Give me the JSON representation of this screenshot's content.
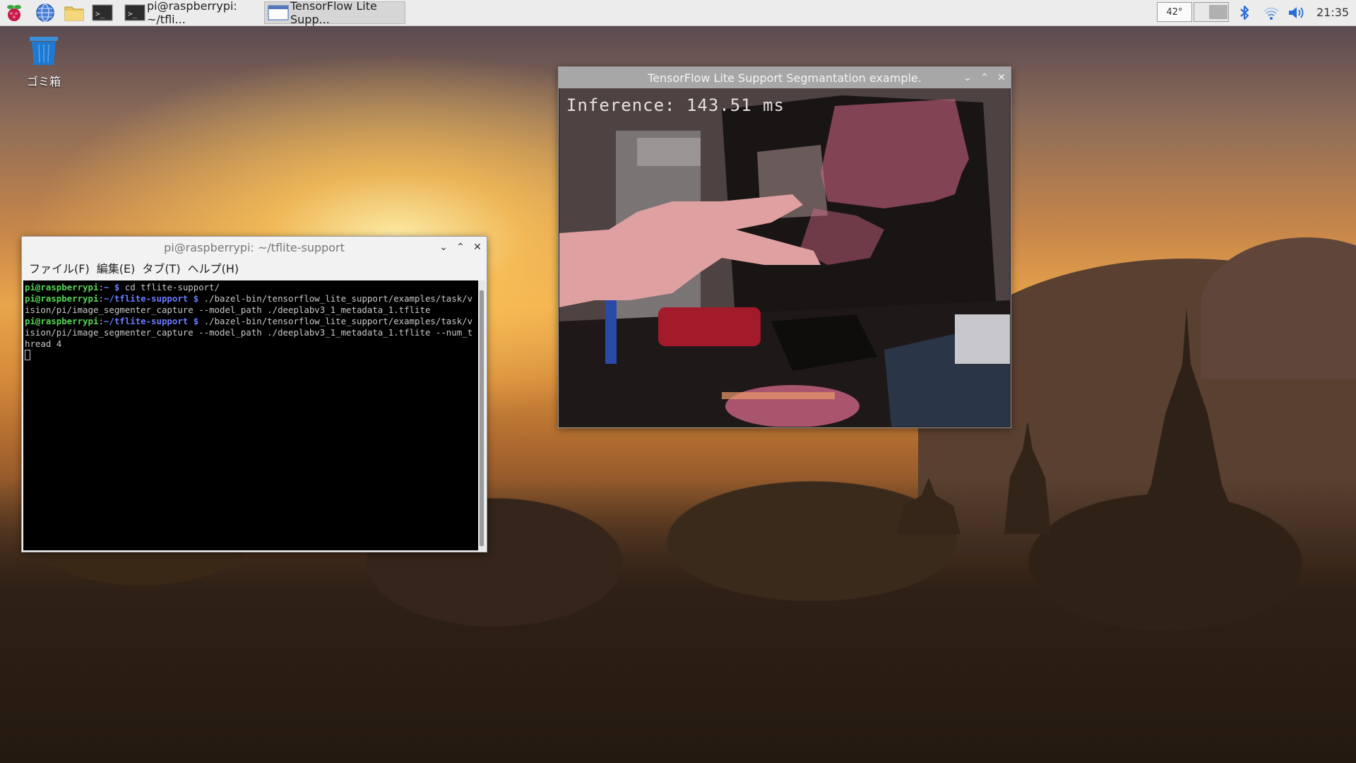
{
  "taskbar": {
    "launchers": [
      {
        "icon": "raspberry-menu-icon"
      },
      {
        "icon": "web-browser-icon"
      },
      {
        "icon": "file-manager-icon"
      },
      {
        "icon": "terminal-icon"
      }
    ],
    "tasks": [
      {
        "label": "pi@raspberrypi: ~/tfli...",
        "icon": "terminal-icon",
        "active": false
      },
      {
        "label": "TensorFlow Lite Supp...",
        "icon": "window-icon",
        "active": true
      }
    ],
    "tray": {
      "cpu_temp": "42°",
      "clock": "21:35"
    }
  },
  "desktop": {
    "trash_label": "ゴミ箱"
  },
  "terminal": {
    "title": "pi@raspberrypi: ~/tflite-support",
    "menu": [
      "ファイル(F)",
      "編集(E)",
      "タブ(T)",
      "ヘルプ(H)"
    ],
    "lines": [
      {
        "user": "pi@raspberrypi",
        "path": "~",
        "cmd": "cd tflite-support/"
      },
      {
        "user": "pi@raspberrypi",
        "path": "~/tflite-support",
        "cmd": "./bazel-bin/tensorflow_lite_support/examples/task/vision/pi/image_segmenter_capture --model_path ./deeplabv3_1_metadata_1.tflite"
      },
      {
        "user": "pi@raspberrypi",
        "path": "~/tflite-support",
        "cmd": "./bazel-bin/tensorflow_lite_support/examples/task/vision/pi/image_segmenter_capture --model_path ./deeplabv3_1_metadata_1.tflite --num_thread 4"
      }
    ]
  },
  "segmentation_window": {
    "title": "TensorFlow Lite Support Segmantation example.",
    "inference_text": "Inference: 143.51 ms"
  },
  "colors": {
    "prompt_user": "#55d655",
    "prompt_path": "#6a7bff",
    "mask_overlay": "#d86a8a"
  }
}
